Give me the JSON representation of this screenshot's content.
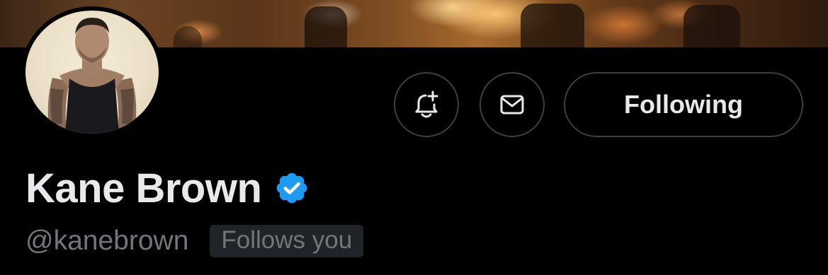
{
  "profile": {
    "display_name": "Kane Brown",
    "verified": true,
    "handle": "@kanebrown",
    "follows_you_badge": "Follows you"
  },
  "actions": {
    "notify_icon": "bell-plus-icon",
    "message_icon": "envelope-icon",
    "following_label": "Following"
  },
  "colors": {
    "background": "#000000",
    "primary_text": "#e7e9ea",
    "secondary_text": "#71767b",
    "border": "#3b4045",
    "verified_blue": "#1d9bf0",
    "badge_bg": "#202327"
  }
}
